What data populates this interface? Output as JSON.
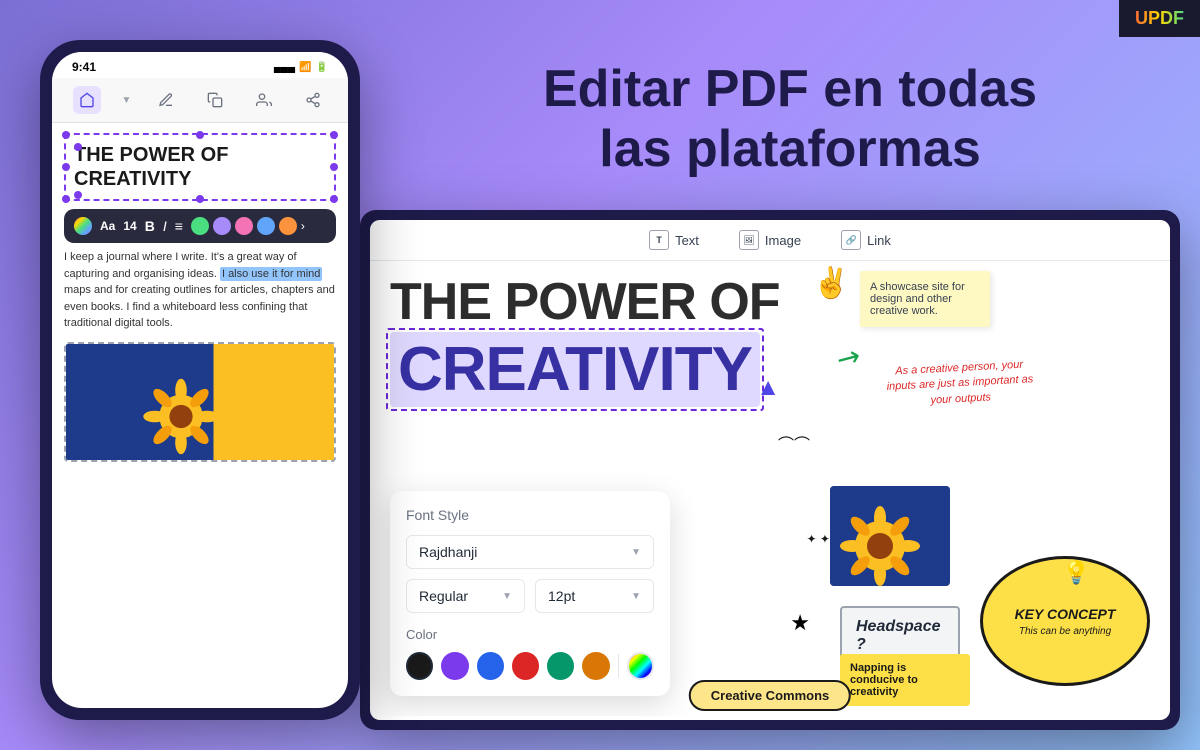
{
  "app": {
    "logo": "UPDF",
    "headline_line1": "Editar PDF en todas",
    "headline_line2": "las plataformas"
  },
  "phone": {
    "status_time": "9:41",
    "title_line1": "THE POWER OF",
    "title_line2": "CREATIVITY",
    "body_text": "I keep a journal where I write. It's a great way of capturing and organising ideas. I also use it for mind maps and for creating outlines for articles, chapters and even books. I find a whiteboard less confining that traditional digital tools.",
    "highlight_text": "also use it for mind",
    "font_size": "14",
    "font_weight": "B",
    "font_italic": "I"
  },
  "tablet": {
    "toolbar": {
      "text_label": "Text",
      "image_label": "Image",
      "link_label": "Link"
    },
    "content": {
      "title_line1": "THE POWER OF",
      "title_line2": "CREATIVITY"
    },
    "font_panel": {
      "title": "Font Style",
      "font_family": "Rajdhanji",
      "font_style": "Regular",
      "font_size": "12pt",
      "color_label": "Color"
    },
    "right_deco": {
      "sticky_text": "A showcase site for design and other creative work.",
      "handwritten": "As a creative person, your inputs are just as important as your outputs",
      "key_concept": "KEY CONCEPT",
      "key_concept_sub": "This can be anything",
      "headspace": "Headspace ?",
      "napping": "Napping is conducive to creativity"
    }
  }
}
